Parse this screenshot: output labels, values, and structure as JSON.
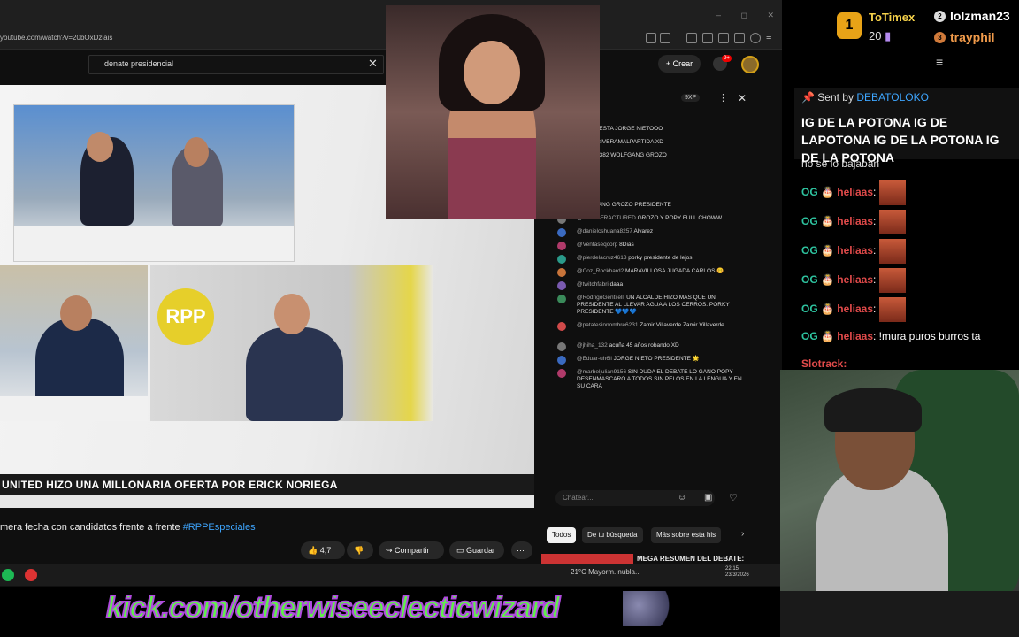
{
  "browser": {
    "url": "youtube.com/watch?v=20bOxDzlais",
    "search_query": "denate presidencial",
    "create_label": "+ Crear",
    "notif_count": "9+"
  },
  "video": {
    "channel_logo": "RPP",
    "ticker": "UNITED HIZO UNA MILLONARIA OFERTA POR ERICK NORIEGA",
    "title_text": "mera fecha con candidatos frente a frente",
    "title_hashtag": "#RPPEspeciales",
    "likes": "4,7 K",
    "share_label": "Compartir",
    "save_label": "Guardar"
  },
  "yt_chat": {
    "header_label": "cado",
    "gxp": "9XP",
    "messages": [
      {
        "text": "DONDE ESTA JORGE NIETOOO"
      },
      {
        "text": "JAVIERRIVERAMALPARTIDA  XD"
      },
      {
        "text": "llcsgray2382  WOLFGANG GROZO"
      },
      {
        "text": "WOLFGANG GROZO PRESIDENTE"
      },
      {
        "user": "@ATLASFRACTURED",
        "text": "GROZO Y POPY FULL CHOWW"
      },
      {
        "user": "@danielcshuana8257",
        "text": "Alvarez"
      },
      {
        "user": "@Ventaseqcorp",
        "text": "8Dias"
      },
      {
        "user": "@pierdelacruz4613",
        "text": "porky presidente de lejos"
      },
      {
        "user": "@Coz_Rockhard2",
        "text": "MARAVILLOSA JUGADA CARLOS 😊"
      },
      {
        "user": "@twitchfabri",
        "text": "daaa"
      },
      {
        "user": "@RodrigoGentilelli",
        "text": "UN ALCALDE HIZO MAS QUE UN PRESIDENTE AL LLEVAR AGUA A LOS CERROS. PORKY PRESIDENTE 💙💙💙"
      },
      {
        "user": "@patatesinnombre6231",
        "text": "Zamir Villaverde Zamir Villaverde"
      },
      {
        "user": "@jhiha_132",
        "text": "acuña 45 años robando XD"
      },
      {
        "user": "@Eduar-uh6ll",
        "text": "JORGE NIETO PRESIDENTE 🌟"
      },
      {
        "user": "@marbeljulian9156",
        "text": "SIN DUDA EL DEBATE LO GANO POPY DESENMASCARO A TODOS SIN PELOS EN LA LENGUA Y EN SU CARA"
      }
    ],
    "input_placeholder": "Chatear...",
    "chips": [
      "Todos",
      "De tu búsqueda",
      "Más sobre esta his"
    ],
    "related_title": "MEGA RESUMEN DEL DEBATE:"
  },
  "taskbar": {
    "weather": "21°C  Mayorm. nubla...",
    "time": "22:15",
    "date": "23/3/2026"
  },
  "banner": {
    "text": "kick.com/otherwiseeclecticwizard"
  },
  "kick": {
    "top_rank": "1",
    "top_user": "ToTimex",
    "top_count": "20",
    "user2": "lolzman23",
    "user3": "trayphil",
    "pinned_sent_by": "Sent by",
    "pinned_user": "DEBATOLOKO",
    "pinned_message": "IG DE LA POTONA IG DE LAPOTONA IG DE LA POTONA IG DE LA POTONA",
    "prev_message": "no se lo bajaban",
    "messages": [
      {
        "user": "heliaas",
        "text": ""
      },
      {
        "user": "heliaas",
        "text": ""
      },
      {
        "user": "heliaas",
        "text": ""
      },
      {
        "user": "heliaas",
        "text": ""
      },
      {
        "user": "heliaas",
        "text": ""
      },
      {
        "user": "heliaas",
        "text": "!mura puros burros ta"
      }
    ],
    "last_user": "Slotrack"
  },
  "colors": {
    "accent_green": "#5ff04a",
    "accent_purple": "#b04adf",
    "kick_name": "#e04a4a",
    "yt_link": "#3ea6ff",
    "sub_badge": "#e8a317"
  }
}
